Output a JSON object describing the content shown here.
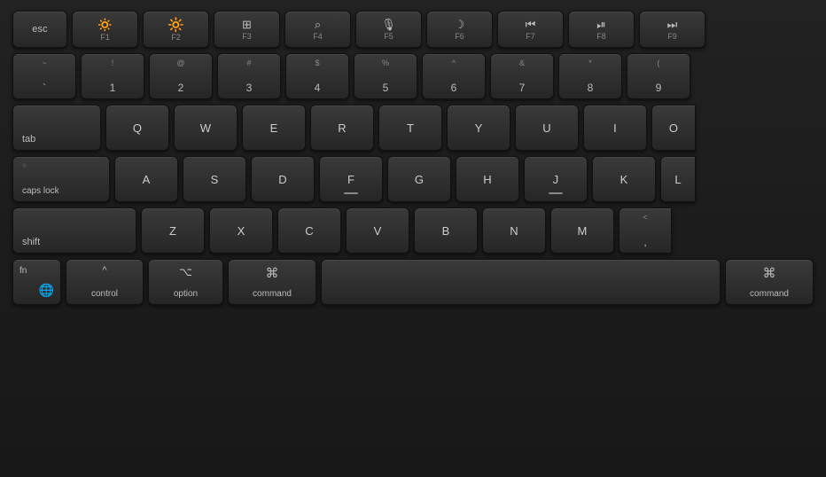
{
  "keyboard": {
    "background": "#1c1c1c",
    "rows": {
      "function_row": {
        "keys": [
          {
            "id": "esc",
            "label": "esc",
            "type": "esc"
          },
          {
            "id": "f1",
            "main": "☀",
            "sub": "F1",
            "type": "fn"
          },
          {
            "id": "f2",
            "main": "☀",
            "sub": "F2",
            "type": "fn"
          },
          {
            "id": "f3",
            "main": "⊞",
            "sub": "F3",
            "type": "fn"
          },
          {
            "id": "f4",
            "main": "🔍",
            "sub": "F4",
            "type": "fn"
          },
          {
            "id": "f5",
            "main": "🎤",
            "sub": "F5",
            "type": "fn"
          },
          {
            "id": "f6",
            "main": "☽",
            "sub": "F6",
            "type": "fn"
          },
          {
            "id": "f7",
            "main": "⏮",
            "sub": "F7",
            "type": "fn"
          },
          {
            "id": "f8",
            "main": "⏯",
            "sub": "F8",
            "type": "fn"
          },
          {
            "id": "f9",
            "main": "⏭",
            "sub": "F9",
            "type": "fn"
          }
        ]
      },
      "number_row": {
        "keys": [
          {
            "id": "tilde",
            "top": "~",
            "bottom": "`"
          },
          {
            "id": "1",
            "top": "!",
            "bottom": "1"
          },
          {
            "id": "2",
            "top": "@",
            "bottom": "2"
          },
          {
            "id": "3",
            "top": "#",
            "bottom": "3"
          },
          {
            "id": "4",
            "top": "$",
            "bottom": "4"
          },
          {
            "id": "5",
            "top": "%",
            "bottom": "5"
          },
          {
            "id": "6",
            "top": "^",
            "bottom": "6"
          },
          {
            "id": "7",
            "top": "&",
            "bottom": "7"
          },
          {
            "id": "8",
            "top": "*",
            "bottom": "8"
          },
          {
            "id": "9",
            "top": "(",
            "bottom": "9"
          }
        ]
      },
      "qwerty_row": {
        "keys": [
          "Q",
          "W",
          "E",
          "R",
          "T",
          "Y",
          "U",
          "I",
          "O"
        ]
      },
      "asdf_row": {
        "keys": [
          "A",
          "S",
          "D",
          "F",
          "G",
          "H",
          "J",
          "K",
          "L"
        ]
      },
      "zxcv_row": {
        "keys": [
          "Z",
          "X",
          "C",
          "V",
          "B",
          "N",
          "M"
        ]
      },
      "bottom_row": {
        "fn": "fn",
        "globe": "🌐",
        "control_top": "^",
        "control_bottom": "control",
        "option_top": "⌥",
        "option_bottom": "option",
        "command_left_top": "⌘",
        "command_left_bottom": "command",
        "command_right_top": "⌘",
        "command_right_bottom": "command"
      },
      "special": {
        "tab": "tab",
        "caps_lock": "caps lock",
        "shift": "shift"
      }
    }
  }
}
